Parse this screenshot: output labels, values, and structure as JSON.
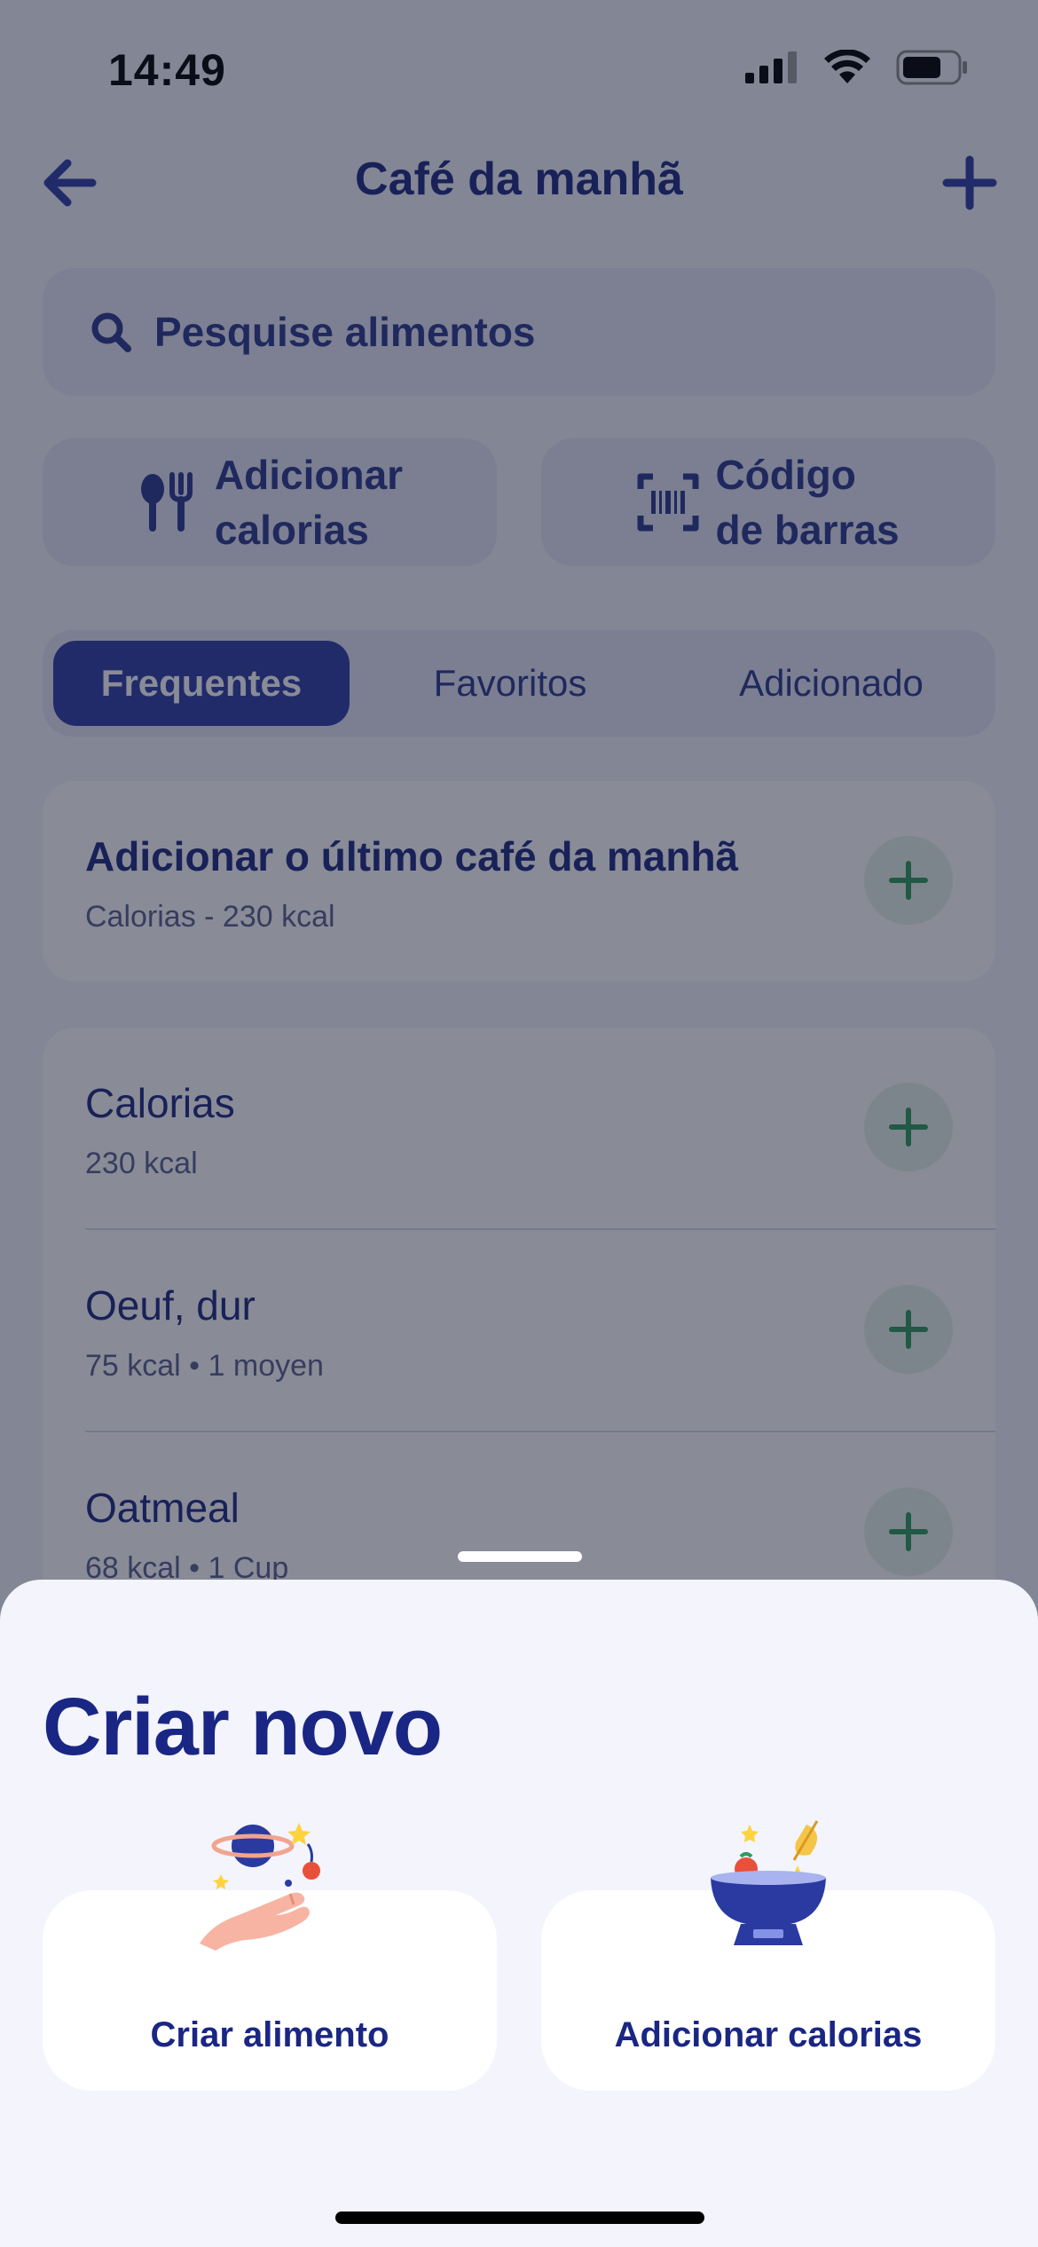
{
  "status_bar": {
    "time": "14:49"
  },
  "header": {
    "title": "Café da manhã"
  },
  "search": {
    "placeholder": "Pesquise alimentos"
  },
  "actions": {
    "add_calories": "Adicionar\ncalorias",
    "barcode": "Código\nde barras"
  },
  "tabs": [
    {
      "label": "Frequentes",
      "active": true
    },
    {
      "label": "Favoritos",
      "active": false
    },
    {
      "label": "Adicionado",
      "active": false
    }
  ],
  "last_meal": {
    "title": "Adicionar o último café da manhã",
    "subtitle": "Calorias - 230 kcal"
  },
  "items": [
    {
      "name": "Calorias",
      "detail": "230 kcal"
    },
    {
      "name": "Oeuf, dur",
      "detail": "75 kcal • 1 moyen"
    },
    {
      "name": "Oatmeal",
      "detail": "68 kcal • 1 Cup"
    }
  ],
  "sheet": {
    "title": "Criar novo",
    "options": [
      {
        "label": "Criar alimento",
        "icon": "hand-planet-icon"
      },
      {
        "label": "Adicionar calorias",
        "icon": "scale-bowl-icon"
      }
    ]
  },
  "colors": {
    "primary": "#2f3fa6",
    "title": "#1d2a82",
    "plus_green": "#2f9a5f"
  }
}
